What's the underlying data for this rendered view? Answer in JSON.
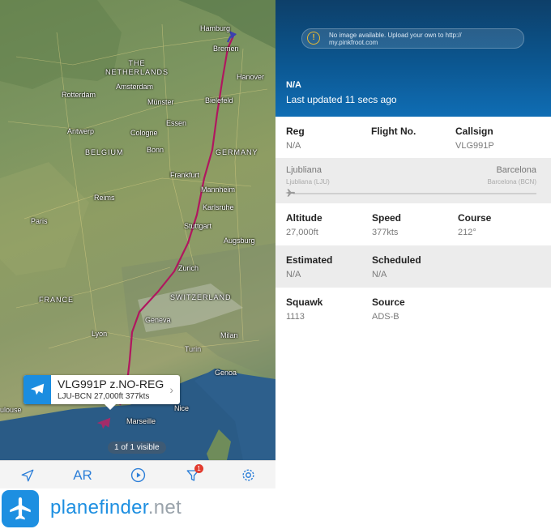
{
  "map": {
    "cities": [
      {
        "name": "Hamburg"
      },
      {
        "name": "Bremen"
      },
      {
        "name": "Hanover"
      },
      {
        "name": "Amsterdam"
      },
      {
        "name": "Rotterdam"
      },
      {
        "name": "Münster"
      },
      {
        "name": "Bielefeld"
      },
      {
        "name": "Essen"
      },
      {
        "name": "Antwerp"
      },
      {
        "name": "Cologne"
      },
      {
        "name": "Bonn"
      },
      {
        "name": "Frankfurt"
      },
      {
        "name": "Mannheim"
      },
      {
        "name": "Karlsruhe"
      },
      {
        "name": "Reims"
      },
      {
        "name": "Paris"
      },
      {
        "name": "Stuttgart"
      },
      {
        "name": "Augsburg"
      },
      {
        "name": "Zurich"
      },
      {
        "name": "Geneva"
      },
      {
        "name": "Lyon"
      },
      {
        "name": "Milan"
      },
      {
        "name": "Turin"
      },
      {
        "name": "Genoa"
      },
      {
        "name": "Marseille"
      },
      {
        "name": "Nice"
      },
      {
        "name": "ulouse"
      }
    ],
    "countries": [
      {
        "name": "THE\nNETHERLANDS"
      },
      {
        "name": "BELGIUM"
      },
      {
        "name": "GERMANY"
      },
      {
        "name": "FRANCE"
      },
      {
        "name": "SWITZERLAND"
      }
    ],
    "callout": {
      "title": "VLG991P z.NO-REG",
      "subtitle": "LJU-BCN 27,000ft 377kts"
    },
    "visible_count": "1 of 1 visible",
    "route_color": "#b0175f"
  },
  "toolbar": {
    "ar_label": "AR",
    "filter_badge": "1",
    "icons": [
      "location-arrow-icon",
      "play-icon",
      "filter-icon",
      "gear-icon"
    ]
  },
  "brand": {
    "name": "planefinder",
    "tld": ".net",
    "color": "#1d8fe1"
  },
  "detail": {
    "no_image": "No image available. Upload your own to http://\nmy.pinkfroot.com",
    "title": "N/A",
    "updated": "Last updated 11 secs ago",
    "reg": {
      "label": "Reg",
      "value": "N/A"
    },
    "flight_no": {
      "label": "Flight No.",
      "value": ""
    },
    "callsign": {
      "label": "Callsign",
      "value": "VLG991P"
    },
    "route": {
      "from": "Ljubliana",
      "from_sub": "Ljubliana (LJU)",
      "to": "Barcelona",
      "to_sub": "Barcelona (BCN)"
    },
    "altitude": {
      "label": "Altitude",
      "value": "27,000ft"
    },
    "speed": {
      "label": "Speed",
      "value": "377kts"
    },
    "course": {
      "label": "Course",
      "value": "212°"
    },
    "estimated": {
      "label": "Estimated",
      "value": "N/A"
    },
    "scheduled": {
      "label": "Scheduled",
      "value": "N/A"
    },
    "squawk": {
      "label": "Squawk",
      "value": "1113"
    },
    "source": {
      "label": "Source",
      "value": "ADS-B"
    }
  }
}
